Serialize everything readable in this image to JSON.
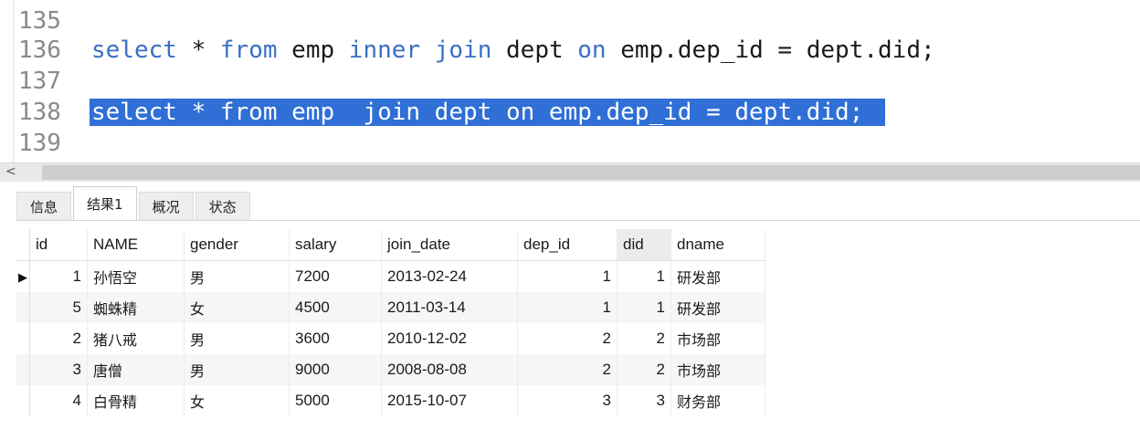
{
  "editor": {
    "lines": [
      {
        "num": "135",
        "parts": []
      },
      {
        "num": "136",
        "parts": [
          {
            "t": "select",
            "k": "kw"
          },
          {
            "t": " * ",
            "k": "tx"
          },
          {
            "t": "from",
            "k": "kw"
          },
          {
            "t": " emp ",
            "k": "tx"
          },
          {
            "t": "inner",
            "k": "kw"
          },
          {
            "t": " ",
            "k": "tx"
          },
          {
            "t": "join",
            "k": "kw"
          },
          {
            "t": " dept ",
            "k": "tx"
          },
          {
            "t": "on",
            "k": "kw"
          },
          {
            "t": " emp.dep_id = dept.did;",
            "k": "tx"
          }
        ]
      },
      {
        "num": "137",
        "parts": []
      },
      {
        "num": "138",
        "selected": true,
        "text": "select * from emp  join dept on emp.dep_id = dept.did;"
      },
      {
        "num": "139",
        "parts": []
      }
    ]
  },
  "scrollbar": {
    "left_arrow": "<"
  },
  "tabs": [
    {
      "label": "信息",
      "active": false
    },
    {
      "label": "结果1",
      "active": true
    },
    {
      "label": "概况",
      "active": false
    },
    {
      "label": "状态",
      "active": false
    }
  ],
  "table": {
    "columns": [
      "id",
      "NAME",
      "gender",
      "salary",
      "join_date",
      "dep_id",
      "did",
      "dname"
    ],
    "current_row_marker": "▶",
    "rows": [
      [
        "1",
        "孙悟空",
        "男",
        "7200",
        "2013-02-24",
        "1",
        "1",
        "研发部"
      ],
      [
        "5",
        "蜘蛛精",
        "女",
        "4500",
        "2011-03-14",
        "1",
        "1",
        "研发部"
      ],
      [
        "2",
        "猪八戒",
        "男",
        "3600",
        "2010-12-02",
        "2",
        "2",
        "市场部"
      ],
      [
        "3",
        "唐僧",
        "男",
        "9000",
        "2008-08-08",
        "2",
        "2",
        "市场部"
      ],
      [
        "4",
        "白骨精",
        "女",
        "5000",
        "2015-10-07",
        "3",
        "3",
        "财务部"
      ]
    ]
  }
}
